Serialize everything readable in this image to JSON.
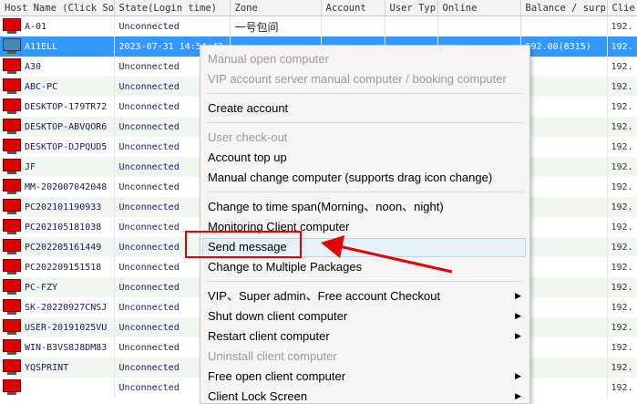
{
  "columns": [
    "Host Name (Click So",
    "State(Login time)",
    "Zone",
    "Account",
    "User Typ",
    "Online",
    "Balance / surp",
    "Clie"
  ],
  "rows": [
    {
      "host": "A-01",
      "state": "Unconnected",
      "zone": "一号包间",
      "account": "",
      "user_type": "",
      "online": "",
      "balance": "",
      "client": "192."
    },
    {
      "host": "A11ELL",
      "state": "2023-07-31 14:54:42",
      "zone": "",
      "account": "",
      "user_type": "",
      "online": "",
      "balance": "592.00(8315)",
      "client": "192.",
      "selected": true
    },
    {
      "host": "A30",
      "state": "Unconnected",
      "zone": "",
      "account": "",
      "user_type": "",
      "online": "",
      "balance": "",
      "client": "192."
    },
    {
      "host": "ABC-PC",
      "state": "Unconnected",
      "zone": "",
      "account": "",
      "user_type": "",
      "online": "",
      "balance": "",
      "client": "192."
    },
    {
      "host": "DESKTOP-179TR72",
      "state": "Unconnected",
      "zone": "",
      "account": "",
      "user_type": "",
      "online": "",
      "balance": "",
      "client": "192."
    },
    {
      "host": "DESKTOP-ABVQOR6",
      "state": "Unconnected",
      "zone": "",
      "account": "",
      "user_type": "",
      "online": "",
      "balance": "",
      "client": "192."
    },
    {
      "host": "DESKTOP-DJPQUD5",
      "state": "Unconnected",
      "zone": "",
      "account": "",
      "user_type": "",
      "online": "",
      "balance": "",
      "client": "192."
    },
    {
      "host": "JF",
      "state": "Unconnected",
      "zone": "",
      "account": "",
      "user_type": "",
      "online": "",
      "balance": "",
      "client": "192."
    },
    {
      "host": "MM-202007042048",
      "state": "Unconnected",
      "zone": "",
      "account": "",
      "user_type": "",
      "online": "",
      "balance": "",
      "client": "192."
    },
    {
      "host": "PC202101190933",
      "state": "Unconnected",
      "zone": "",
      "account": "",
      "user_type": "",
      "online": "",
      "balance": "",
      "client": "192."
    },
    {
      "host": "PC202105181038",
      "state": "Unconnected",
      "zone": "",
      "account": "",
      "user_type": "",
      "online": "",
      "balance": "",
      "client": "192."
    },
    {
      "host": "PC202205161449",
      "state": "Unconnected",
      "zone": "",
      "account": "",
      "user_type": "",
      "online": "",
      "balance": "",
      "client": "192."
    },
    {
      "host": "PC202209151518",
      "state": "Unconnected",
      "zone": "",
      "account": "",
      "user_type": "",
      "online": "",
      "balance": "",
      "client": "192."
    },
    {
      "host": "PC-FZY",
      "state": "Unconnected",
      "zone": "",
      "account": "",
      "user_type": "",
      "online": "",
      "balance": "",
      "client": "192."
    },
    {
      "host": "SK-20220927CNSJ",
      "state": "Unconnected",
      "zone": "",
      "account": "",
      "user_type": "",
      "online": "",
      "balance": "",
      "client": "192."
    },
    {
      "host": "USER-20191025VU",
      "state": "Unconnected",
      "zone": "",
      "account": "",
      "user_type": "",
      "online": "",
      "balance": "",
      "client": "192."
    },
    {
      "host": "WIN-B3VS8J8DM83",
      "state": "Unconnected",
      "zone": "",
      "account": "",
      "user_type": "",
      "online": "",
      "balance": "",
      "client": "192."
    },
    {
      "host": "YQSPRINT",
      "state": "Unconnected",
      "zone": "",
      "account": "",
      "user_type": "",
      "online": "",
      "balance": "",
      "client": "192."
    },
    {
      "host": "",
      "state": "Unconnected",
      "zone": "",
      "account": "",
      "user_type": "",
      "online": "",
      "balance": "",
      "client": "192."
    }
  ],
  "menu": [
    {
      "label": "Manual open computer",
      "disabled": true
    },
    {
      "label": "VIP account server manual computer / booking computer",
      "disabled": true
    },
    {
      "separator": true
    },
    {
      "label": "Create account"
    },
    {
      "separator": true
    },
    {
      "label": "User check-out",
      "disabled": true
    },
    {
      "label": "Account top up"
    },
    {
      "label": "Manual change computer (supports drag icon change)"
    },
    {
      "separator": true
    },
    {
      "label": "Change to time span(Morning、noon、night)"
    },
    {
      "label": "Monitoring Client computer"
    },
    {
      "label": "Send message",
      "highlighted": true
    },
    {
      "label": "Change to Multiple Packages"
    },
    {
      "separator": true
    },
    {
      "label": "VIP、Super admin、Free account Checkout",
      "submenu": true
    },
    {
      "label": "Shut down client computer",
      "submenu": true
    },
    {
      "label": "Restart client computer",
      "submenu": true
    },
    {
      "label": "Uninstall client computer",
      "disabled": true
    },
    {
      "label": "Free open client computer",
      "submenu": true
    },
    {
      "label": "Client Lock Screen",
      "submenu": true
    }
  ],
  "icons": {
    "computer": "computer-icon",
    "submenu": "submenu-arrow-icon",
    "pointer": "red-arrow-pointer"
  },
  "colors": {
    "selection": "#3399ff",
    "offline_computer": "#dd0000",
    "callout": "#e60000",
    "hover": "#e6f1fb"
  }
}
